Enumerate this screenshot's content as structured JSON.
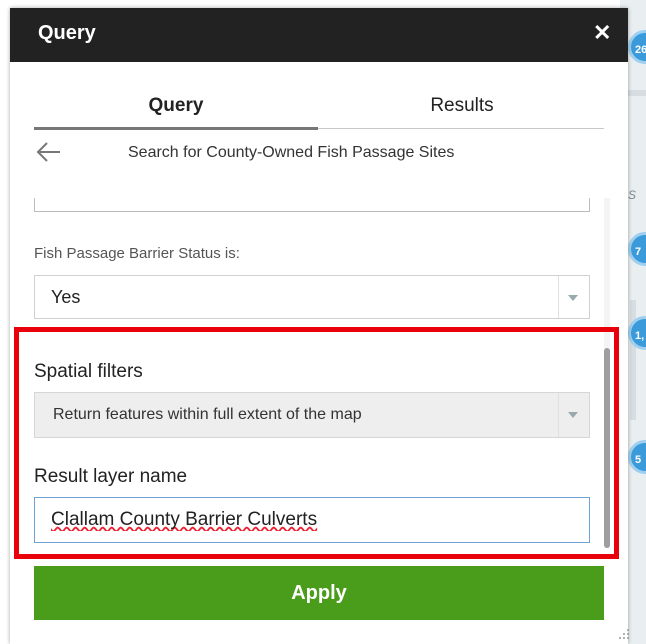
{
  "panel": {
    "title": "Query",
    "close_label": "✕"
  },
  "tabs": [
    {
      "label": "Query",
      "active": true
    },
    {
      "label": "Results",
      "active": false
    }
  ],
  "subtitle": "Search for County-Owned Fish Passage Sites",
  "filters": {
    "fish_passage_label": "Fish Passage Barrier Status is:",
    "fish_passage_value": "Yes",
    "spatial_label": "Spatial filters",
    "spatial_value": "Return features within full extent of the map",
    "result_layer_label": "Result layer name",
    "result_layer_value": "Clallam County Barrier Culverts"
  },
  "apply_label": "Apply",
  "map_clusters": [
    "26",
    "7",
    "1,",
    "5"
  ],
  "map_letter": "S",
  "colors": {
    "titlebar": "#222222",
    "apply": "#4a9c1b",
    "highlight": "#e8000b",
    "cluster": "#3b9ad9"
  }
}
